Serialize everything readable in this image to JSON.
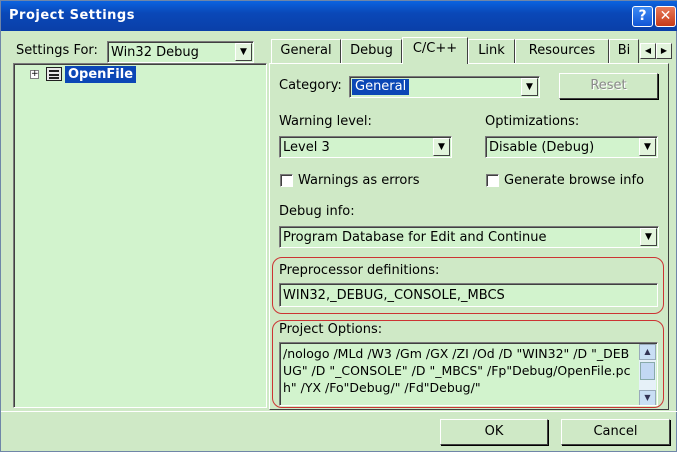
{
  "window": {
    "title": "Project Settings",
    "help_button": "?",
    "close_button": "✕"
  },
  "left": {
    "settings_for_label": "Settings For:",
    "settings_for_value": "Win32 Debug",
    "tree": {
      "expander": "+",
      "project_name": "OpenFile"
    }
  },
  "tabs": [
    {
      "label": "General"
    },
    {
      "label": "Debug"
    },
    {
      "label": "C/C++",
      "active": true
    },
    {
      "label": "Link"
    },
    {
      "label": "Resources"
    },
    {
      "label": "Bi"
    }
  ],
  "tab_scroll": {
    "left": "◀",
    "right": "▶"
  },
  "panel": {
    "category_label": "Category:",
    "category_value": "General",
    "reset_button": "Reset",
    "warning_level_label": "Warning level:",
    "warning_level_value": "Level 3",
    "optimizations_label": "Optimizations:",
    "optimizations_value": "Disable (Debug)",
    "warnings_as_errors_label": "Warnings as errors",
    "generate_browse_info_label": "Generate browse info",
    "debug_info_label": "Debug info:",
    "debug_info_value": "Program Database for Edit and Continue",
    "preprocessor_label": "Preprocessor definitions:",
    "preprocessor_value": "WIN32,_DEBUG,_CONSOLE,_MBCS",
    "project_options_label": "Project Options:",
    "project_options_value": "/nologo /MLd /W3 /Gm /GX /ZI /Od /D \"WIN32\" /D \"_DEBUG\" /D \"_CONSOLE\" /D \"_MBCS\" /Fp\"Debug/OpenFile.pch\" /YX /Fo\"Debug/\" /Fd\"Debug/\""
  },
  "footer": {
    "ok_button": "OK",
    "cancel_button": "Cancel"
  },
  "arrows": {
    "down": "▼",
    "up": "▲"
  }
}
